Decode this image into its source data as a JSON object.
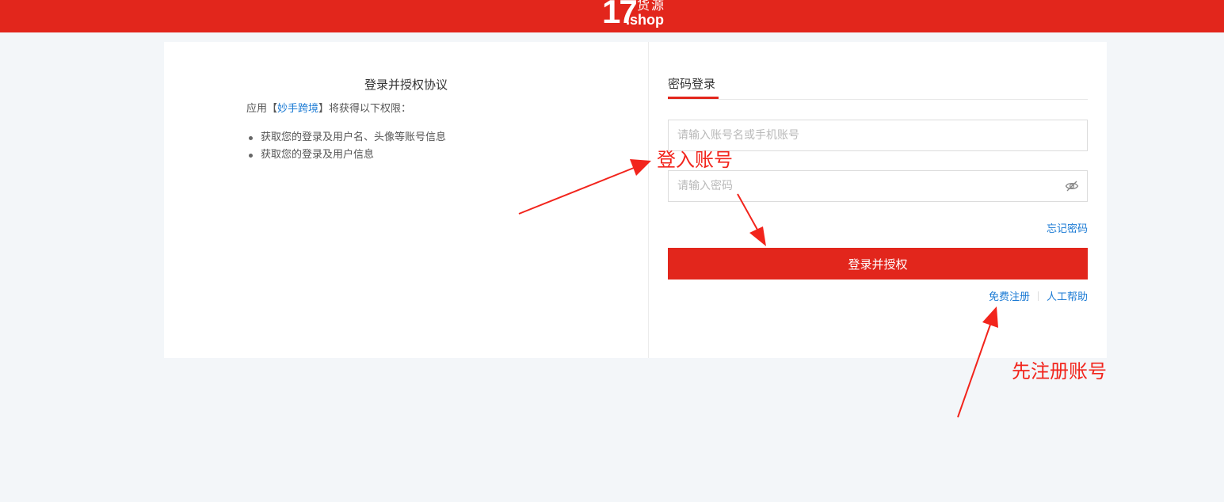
{
  "header": {
    "logo_mark": "17",
    "logo_cn": "货源",
    "logo_shop": ".shop",
    "bg_color": "#e2261c"
  },
  "agreement": {
    "title": "登录并授权协议",
    "desc_prefix": "应用【",
    "app_name": "妙手跨境",
    "desc_suffix": "】将获得以下权限：",
    "permissions": [
      "获取您的登录及用户名、头像等账号信息",
      "获取您的登录及用户信息"
    ]
  },
  "login": {
    "tab_label": "密码登录",
    "account_placeholder": "请输入账号名或手机账号",
    "password_placeholder": "请输入密码",
    "password_toggle_icon": "eye-slash-icon",
    "forgot_label": "忘记密码",
    "submit_label": "登录并授权",
    "register_label": "免费注册",
    "help_label": "人工帮助",
    "accent_color": "#e2261c",
    "link_color": "#1c7bd4"
  },
  "annotations": {
    "login_note": "登入账号",
    "register_note": "先注册账号",
    "color": "#f2241c"
  }
}
